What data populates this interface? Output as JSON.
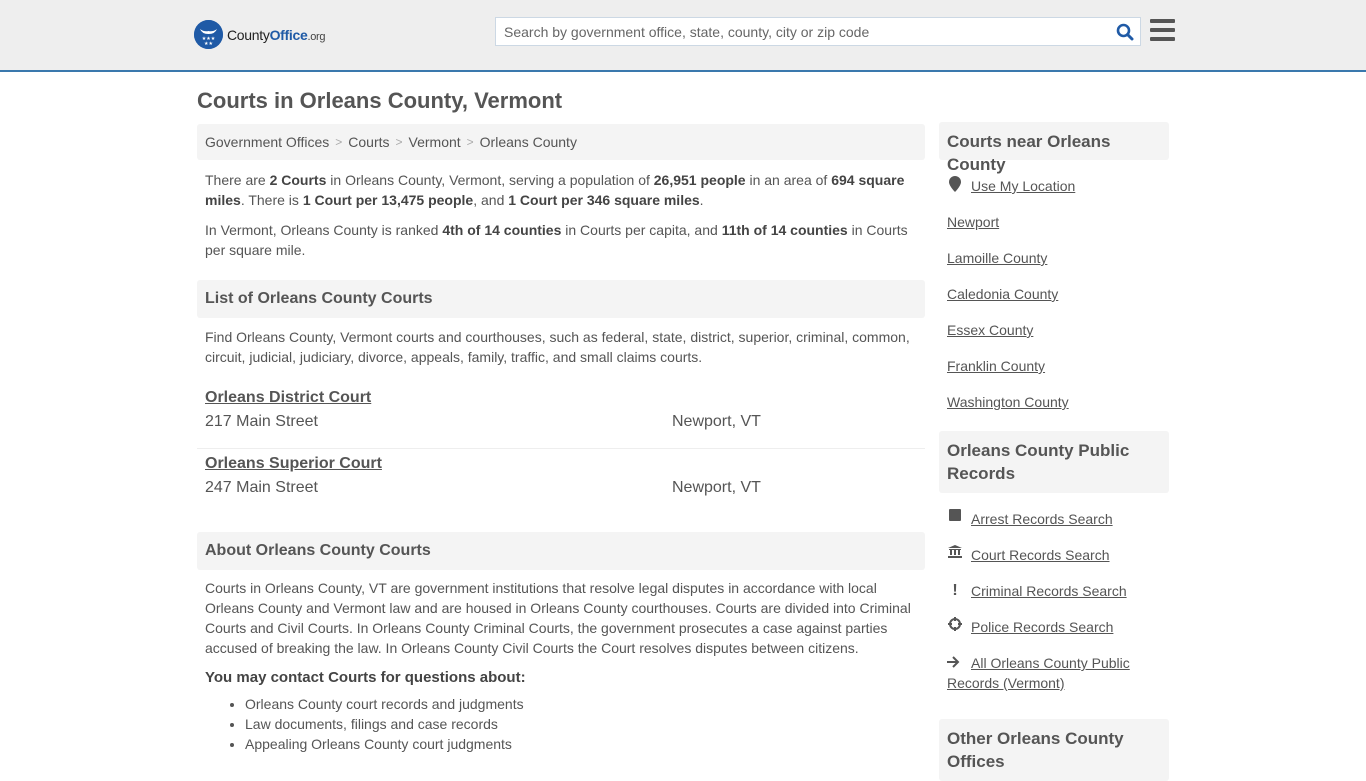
{
  "header": {
    "logo": {
      "part1": "County",
      "part2": "Office",
      "part3": ".org"
    },
    "search_placeholder": "Search by government office, state, county, city or zip code",
    "accent_color": "#3a78ad",
    "brand_color": "#1f5aa6"
  },
  "page_title": "Courts in Orleans County, Vermont",
  "breadcrumb": [
    {
      "label": "Government Offices"
    },
    {
      "label": "Courts"
    },
    {
      "label": "Vermont"
    },
    {
      "label": "Orleans County"
    }
  ],
  "summary": {
    "p1": {
      "t1": "There are ",
      "b1": "2 Courts",
      "t2": " in Orleans County, Vermont, serving a population of ",
      "b2": "26,951 people",
      "t3": " in an area of ",
      "b3": "694 square miles",
      "t4": ". There is ",
      "b4": "1 Court per 13,475 people",
      "t5": ", and ",
      "b5": "1 Court per 346 square miles",
      "t6": "."
    },
    "p2": {
      "t1": "In Vermont, Orleans County is ranked ",
      "b1": "4th of 14 counties",
      "t2": " in Courts per capita, and ",
      "b2": "11th of 14 counties",
      "t3": " in Courts per square mile."
    }
  },
  "list_section": {
    "heading": "List of Orleans County Courts",
    "description": "Find Orleans County, Vermont courts and courthouses, such as federal, state, district, superior, criminal, common, circuit, judicial, judiciary, divorce, appeals, family, traffic, and small claims courts.",
    "courts": [
      {
        "name": "Orleans District Court",
        "address": "217 Main Street",
        "city": "Newport, VT"
      },
      {
        "name": "Orleans Superior Court",
        "address": "247 Main Street",
        "city": "Newport, VT"
      }
    ]
  },
  "about_section": {
    "heading": "About Orleans County Courts",
    "text": "Courts in Orleans County, VT are government institutions that resolve legal disputes in accordance with local Orleans County and Vermont law and are housed in Orleans County courthouses. Courts are divided into Criminal Courts and Civil Courts. In Orleans County Criminal Courts, the government prosecutes a case against parties accused of breaking the law. In Orleans County Civil Courts the Court resolves disputes between citizens.",
    "contact_heading": "You may contact Courts for questions about:",
    "contact_items": [
      "Orleans County court records and judgments",
      "Law documents, filings and case records",
      "Appealing Orleans County court judgments"
    ]
  },
  "sidebar": {
    "nearby": {
      "heading": "Courts near Orleans County",
      "use_location": "Use My Location",
      "links": [
        "Newport",
        "Lamoille County",
        "Caledonia County",
        "Essex County",
        "Franklin County",
        "Washington County"
      ]
    },
    "public_records": {
      "heading": "Orleans County Public Records",
      "links": [
        {
          "icon": "square-icon",
          "label": "Arrest Records Search"
        },
        {
          "icon": "courthouse-icon",
          "label": "Court Records Search"
        },
        {
          "icon": "exclamation-icon",
          "label": "Criminal Records Search"
        },
        {
          "icon": "crosshair-icon",
          "label": "Police Records Search"
        },
        {
          "icon": "arrow-right-icon",
          "label": "All Orleans County Public Records (Vermont)"
        }
      ]
    },
    "other_offices": {
      "heading": "Other Orleans County Offices"
    }
  }
}
